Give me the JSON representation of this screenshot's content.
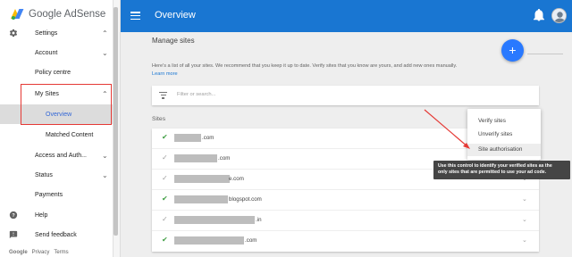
{
  "app": {
    "name": "Google AdSense",
    "title": "Overview",
    "accent": "#1976d2",
    "fab_color": "#2979ff",
    "annotation_color": "#e53935"
  },
  "sidebar": {
    "items": [
      {
        "label": "Settings",
        "icon": "gear-icon"
      },
      {
        "label": "Account"
      },
      {
        "label": "Policy centre"
      },
      {
        "label": "My Sites"
      },
      {
        "label": "Overview"
      },
      {
        "label": "Matched Content"
      },
      {
        "label": "Access and Auth..."
      },
      {
        "label": "Status"
      },
      {
        "label": "Payments"
      },
      {
        "label": "Help",
        "icon": "help-icon"
      },
      {
        "label": "Send feedback",
        "icon": "feedback-icon"
      }
    ],
    "footer": {
      "google": "Google",
      "privacy": "Privacy",
      "terms": "Terms"
    }
  },
  "main": {
    "heading": "Manage sites",
    "add_button": "+",
    "description": "Here's a list of all your sites. We recommend that you keep it up to date. Verify sites that you know are yours, and add new ones manually.",
    "learn_more": "Learn more",
    "search_placeholder": "Filter or search...",
    "sites_label": "Sites",
    "sites": [
      {
        "suffix": ".com",
        "status": "verified"
      },
      {
        "suffix": ".com",
        "status": "unverified"
      },
      {
        "suffix": "e.com",
        "status": "unverified"
      },
      {
        "suffix": "blogspot.com",
        "status": "verified"
      },
      {
        "suffix": ".in",
        "status": "unverified"
      },
      {
        "suffix": ".com",
        "status": "verified"
      }
    ]
  },
  "menu": {
    "items": [
      "Verify sites",
      "Unverify sites",
      "Site authorisation"
    ]
  },
  "tooltip": {
    "line1": "Use this control to identify your verified sites as the",
    "line2": "only sites that are permitted to use your ad code."
  }
}
